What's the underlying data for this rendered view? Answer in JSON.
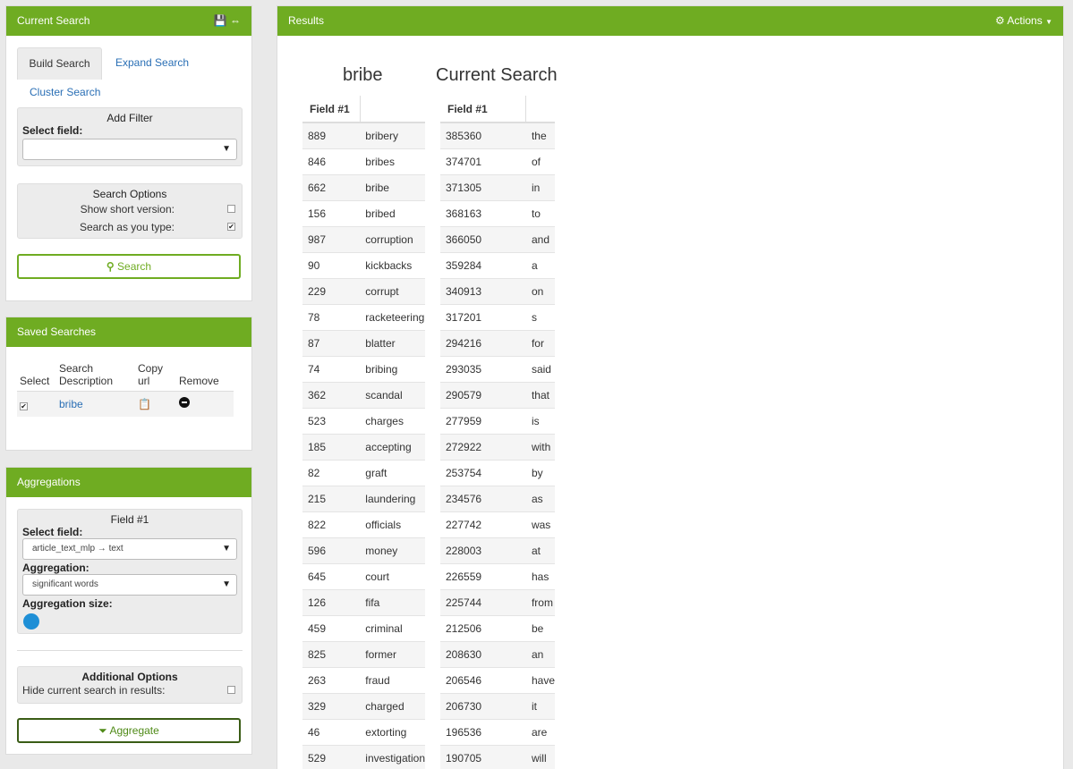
{
  "current_search": {
    "title": "Current Search",
    "icons": "💾 ⇔",
    "tabs": [
      "Build Search",
      "Expand Search",
      "Cluster Search"
    ],
    "add_filter": {
      "title": "Add Filter",
      "select_label": "Select field:",
      "select_value": ""
    },
    "search_options": {
      "title": "Search Options",
      "short_version": "Show short version:",
      "search_as_type": "Search as you type:"
    },
    "search_button": "Search"
  },
  "saved_searches": {
    "title": "Saved Searches",
    "headers": [
      "Select",
      "Search Description",
      "Copy url",
      "Remove"
    ],
    "row_description": "bribe"
  },
  "aggregations": {
    "title": "Aggregations",
    "field_title": "Field #1",
    "select_label": "Select field:",
    "select_value": "article_text_mlp → text",
    "agg_label": "Aggregation:",
    "agg_value": "significant words",
    "size_label": "Aggregation size:",
    "additional_title": "Additional Options",
    "hide_label": "Hide current search in results:",
    "aggregate_button": "Aggregate"
  },
  "results": {
    "title": "Results",
    "actions": "Actions",
    "col1_title": "bribe",
    "col2_title": "Current Search",
    "col_header": "Field #1",
    "bribe_rows": [
      [
        "889",
        "bribery"
      ],
      [
        "846",
        "bribes"
      ],
      [
        "662",
        "bribe"
      ],
      [
        "156",
        "bribed"
      ],
      [
        "987",
        "corruption"
      ],
      [
        "90",
        "kickbacks"
      ],
      [
        "229",
        "corrupt"
      ],
      [
        "78",
        "racketeering"
      ],
      [
        "87",
        "blatter"
      ],
      [
        "74",
        "bribing"
      ],
      [
        "362",
        "scandal"
      ],
      [
        "523",
        "charges"
      ],
      [
        "185",
        "accepting"
      ],
      [
        "82",
        "graft"
      ],
      [
        "215",
        "laundering"
      ],
      [
        "822",
        "officials"
      ],
      [
        "596",
        "money"
      ],
      [
        "645",
        "court"
      ],
      [
        "126",
        "fifa"
      ],
      [
        "459",
        "criminal"
      ],
      [
        "825",
        "former"
      ],
      [
        "263",
        "fraud"
      ],
      [
        "329",
        "charged"
      ],
      [
        "46",
        "extorting"
      ],
      [
        "529",
        "investigation"
      ]
    ],
    "current_rows": [
      [
        "385360",
        "the"
      ],
      [
        "374701",
        "of"
      ],
      [
        "371305",
        "in"
      ],
      [
        "368163",
        "to"
      ],
      [
        "366050",
        "and"
      ],
      [
        "359284",
        "a"
      ],
      [
        "340913",
        "on"
      ],
      [
        "317201",
        "s"
      ],
      [
        "294216",
        "for"
      ],
      [
        "293035",
        "said"
      ],
      [
        "290579",
        "that"
      ],
      [
        "277959",
        "is"
      ],
      [
        "272922",
        "with"
      ],
      [
        "253754",
        "by"
      ],
      [
        "234576",
        "as"
      ],
      [
        "227742",
        "was"
      ],
      [
        "228003",
        "at"
      ],
      [
        "226559",
        "has"
      ],
      [
        "225744",
        "from"
      ],
      [
        "212506",
        "be"
      ],
      [
        "208630",
        "an"
      ],
      [
        "206546",
        "have"
      ],
      [
        "206730",
        "it"
      ],
      [
        "196536",
        "are"
      ],
      [
        "190705",
        "will"
      ]
    ]
  },
  "colors": {
    "accent": "#6fac22",
    "link": "#2a6fb5",
    "slider": "#1e8fd6"
  }
}
